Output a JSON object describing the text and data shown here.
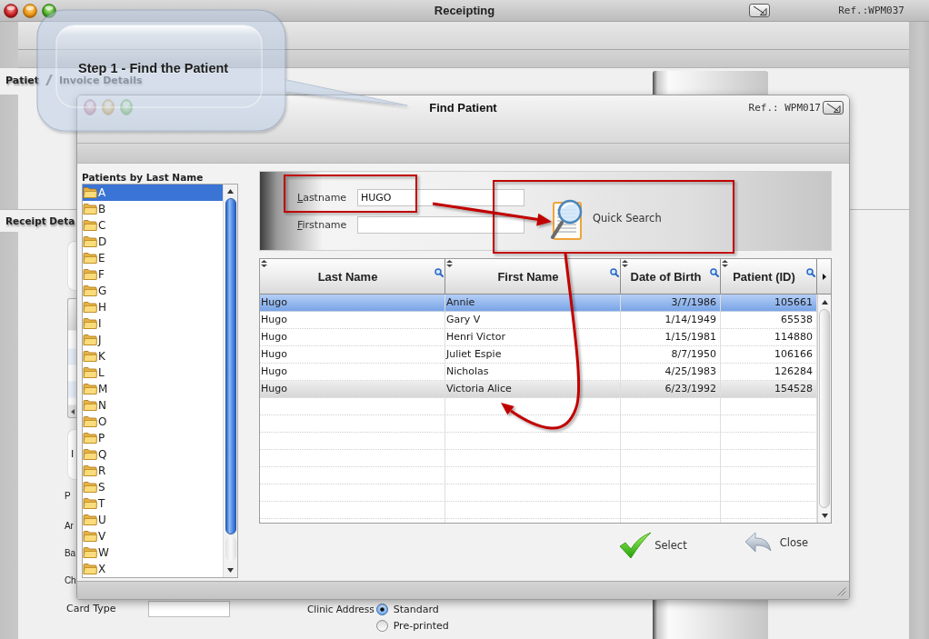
{
  "window": {
    "title": "Receipting",
    "ref": "Ref.:WPM037"
  },
  "callout": {
    "text": "Step 1 - Find the Patient"
  },
  "form": {
    "tabs": [
      {
        "label": "Patiet",
        "selected": true
      },
      {
        "label": "Invoice Details",
        "selected": false
      }
    ],
    "section_title": "Receipt Deta",
    "panel_text": "I",
    "field_labels": [
      "P",
      "Ar",
      "Ba",
      "Ch"
    ],
    "card_type": {
      "label": "Card Type"
    },
    "clinic_address": {
      "label": "Clinic Address",
      "options": [
        {
          "label": "Standard",
          "selected": true
        },
        {
          "label": "Pre-printed",
          "selected": false
        }
      ]
    }
  },
  "dialog": {
    "title": "Find Patient",
    "ref": "Ref.: WPM017",
    "index": {
      "title": "Patients by Last Name",
      "items": [
        {
          "label": "A",
          "selected": true
        },
        {
          "label": "B",
          "selected": false
        },
        {
          "label": "C",
          "selected": false
        },
        {
          "label": "D",
          "selected": false
        },
        {
          "label": "E",
          "selected": false
        },
        {
          "label": "F",
          "selected": false
        },
        {
          "label": "G",
          "selected": false
        },
        {
          "label": "H",
          "selected": false
        },
        {
          "label": "I",
          "selected": false
        },
        {
          "label": "J",
          "selected": false
        },
        {
          "label": "K",
          "selected": false
        },
        {
          "label": "L",
          "selected": false
        },
        {
          "label": "M",
          "selected": false
        },
        {
          "label": "N",
          "selected": false
        },
        {
          "label": "O",
          "selected": false
        },
        {
          "label": "P",
          "selected": false
        },
        {
          "label": "Q",
          "selected": false
        },
        {
          "label": "R",
          "selected": false
        },
        {
          "label": "S",
          "selected": false
        },
        {
          "label": "T",
          "selected": false
        },
        {
          "label": "U",
          "selected": false
        },
        {
          "label": "V",
          "selected": false
        },
        {
          "label": "W",
          "selected": false
        },
        {
          "label": "X",
          "selected": false
        }
      ]
    },
    "search": {
      "fields": [
        {
          "label": "Lastname",
          "mnemonic": true,
          "value": "HUGO"
        },
        {
          "label": "Firstname",
          "mnemonic": true
        }
      ],
      "button": "Quick Search"
    },
    "results": {
      "columns": [
        "Last Name",
        "First Name",
        "Date of Birth",
        "Patient (ID)"
      ],
      "rows": [
        {
          "cells": [
            "Hugo",
            "Annie",
            "3/7/1986",
            "105661"
          ],
          "selected": true,
          "hovered": false
        },
        {
          "cells": [
            "Hugo",
            "Gary V",
            "1/14/1949",
            "65538"
          ],
          "selected": false,
          "hovered": false
        },
        {
          "cells": [
            "Hugo",
            "Henri Victor",
            "1/15/1981",
            "114880"
          ],
          "selected": false,
          "hovered": false
        },
        {
          "cells": [
            "Hugo",
            "Juliet Espie",
            "8/7/1950",
            "106166"
          ],
          "selected": false,
          "hovered": false
        },
        {
          "cells": [
            "Hugo",
            "Nicholas",
            "4/25/1983",
            "126284"
          ],
          "selected": false,
          "hovered": false
        },
        {
          "cells": [
            "Hugo",
            "Victoria Alice",
            "6/23/1992",
            "154528"
          ],
          "selected": false,
          "hovered": true
        }
      ]
    },
    "buttons": [
      {
        "label": "Select",
        "kind": "select"
      },
      {
        "label": "Close",
        "kind": "close"
      }
    ]
  }
}
